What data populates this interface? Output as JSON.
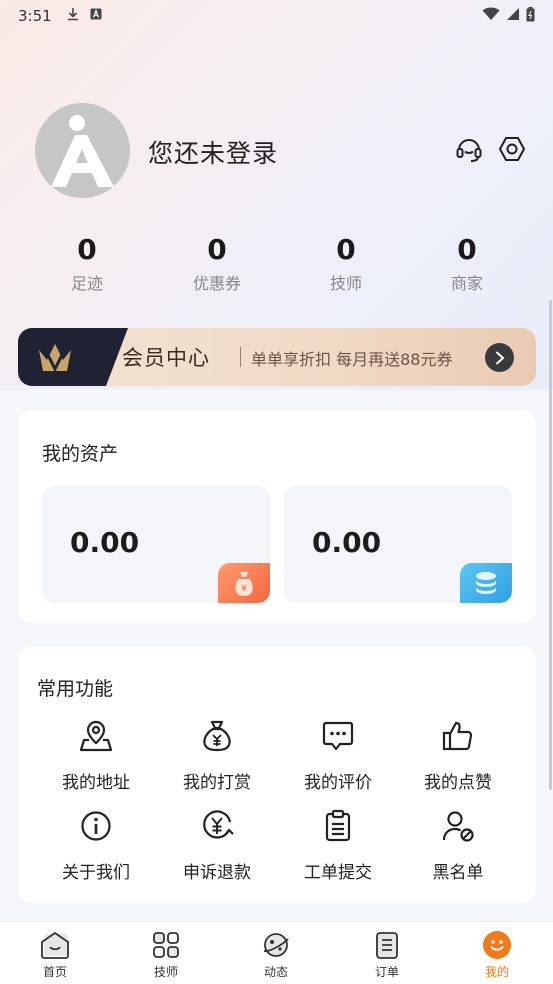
{
  "status_bar": {
    "time": "3:51",
    "icons": [
      "download-icon",
      "a-badge-icon",
      "wifi-icon",
      "signal-icon",
      "battery-icon"
    ]
  },
  "profile": {
    "username": "您还未登录",
    "icons": [
      "headset-icon",
      "settings-hex-icon"
    ]
  },
  "stats": [
    {
      "value": "0",
      "label": "足迹"
    },
    {
      "value": "0",
      "label": "优惠券"
    },
    {
      "value": "0",
      "label": "技师"
    },
    {
      "value": "0",
      "label": "商家"
    }
  ],
  "vip": {
    "title": "会员中心",
    "desc": "单单享折扣 每月再送88元券"
  },
  "assets": {
    "title": "我的资产",
    "items": [
      {
        "value": "0.00",
        "icon": "money-bag-icon",
        "accent": "#f77a53"
      },
      {
        "value": "0.00",
        "icon": "coins-stack-icon",
        "accent": "#3aaee6"
      }
    ]
  },
  "functions": {
    "title": "常用功能",
    "items": [
      {
        "label": "我的地址",
        "icon": "location-pin-icon"
      },
      {
        "label": "我的打赏",
        "icon": "money-bag-icon"
      },
      {
        "label": "我的评价",
        "icon": "chat-bubble-icon"
      },
      {
        "label": "我的点赞",
        "icon": "thumbs-up-icon"
      },
      {
        "label": "关于我们",
        "icon": "info-icon"
      },
      {
        "label": "申诉退款",
        "icon": "refund-icon"
      },
      {
        "label": "工单提交",
        "icon": "clipboard-icon"
      },
      {
        "label": "黑名单",
        "icon": "user-block-icon"
      }
    ]
  },
  "tabbar": {
    "items": [
      {
        "label": "首页",
        "icon": "home-icon"
      },
      {
        "label": "技师",
        "icon": "grid-icon"
      },
      {
        "label": "动态",
        "icon": "planet-icon"
      },
      {
        "label": "订单",
        "icon": "order-list-icon"
      },
      {
        "label": "我的",
        "icon": "smile-icon",
        "active": true
      }
    ],
    "active_color": "#f07a1a"
  }
}
